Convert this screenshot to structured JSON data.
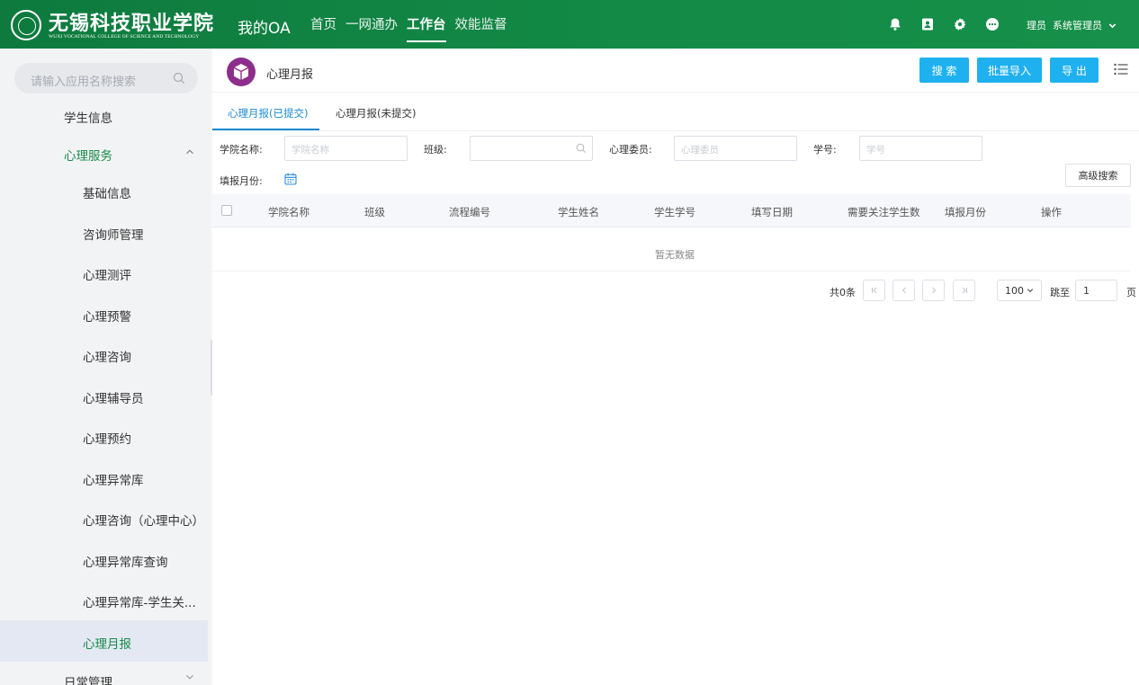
{
  "header": {
    "logo_cn": "无锡科技职业学院",
    "logo_en": "WUXI VOCATIONAL COLLEGE OF SCIENCE AND TECHNOLOGY",
    "oa_title": "我的OA",
    "nav": [
      "首页",
      "一网通办",
      "工作台",
      "效能监督"
    ],
    "active_nav": "工作台",
    "user_role": "理员",
    "user_name": "系统管理员"
  },
  "sidebar": {
    "search_placeholder": "请输入应用名称搜索",
    "items": [
      {
        "label": "学生信息",
        "level": 1
      },
      {
        "label": "心理服务",
        "level": 1,
        "expanded": true
      },
      {
        "label": "基础信息",
        "level": 2
      },
      {
        "label": "咨询师管理",
        "level": 2
      },
      {
        "label": "心理测评",
        "level": 2
      },
      {
        "label": "心理预警",
        "level": 2
      },
      {
        "label": "心理咨询",
        "level": 2
      },
      {
        "label": "心理辅导员",
        "level": 2
      },
      {
        "label": "心理预约",
        "level": 2
      },
      {
        "label": "心理异常库",
        "level": 2
      },
      {
        "label": "心理咨询（心理中心）",
        "level": 2
      },
      {
        "label": "心理异常库查询",
        "level": 2
      },
      {
        "label": "心理异常库-学生关...",
        "level": 2
      },
      {
        "label": "心理月报",
        "level": 2,
        "selected": true
      },
      {
        "label": "日常管理",
        "level": 1
      }
    ]
  },
  "page": {
    "title": "心理月报",
    "buttons": {
      "search": "搜 索",
      "import": "批量导入",
      "export": "导 出"
    },
    "tabs": [
      "心理月报(已提交)",
      "心理月报(未提交)"
    ],
    "filters": {
      "college_label": "学院名称:",
      "college_placeholder": "学院名称",
      "class_label": "班级:",
      "class_placeholder": "",
      "committee_label": "心理委员:",
      "committee_placeholder": "心理委员",
      "student_no_label": "学号:",
      "student_no_placeholder": "学号",
      "month_label": "填报月份:",
      "advanced_search": "高级搜索"
    },
    "table": {
      "columns": [
        "学院名称",
        "班级",
        "流程编号",
        "学生姓名",
        "学生学号",
        "填写日期",
        "需要关注学生数",
        "填报月份",
        "操作"
      ],
      "empty_text": "暂无数据"
    },
    "pagination": {
      "total_text": "共0条",
      "page_size": "100",
      "goto_label": "跳至",
      "current_page": "1",
      "page_unit": "页"
    }
  },
  "colors": {
    "header_green": "#138a46",
    "accent_blue": "#1fb0f0",
    "active_green": "#1a8a4a",
    "tab_blue": "#1a8ad4",
    "app_icon_purple": "#8e2e8c"
  }
}
